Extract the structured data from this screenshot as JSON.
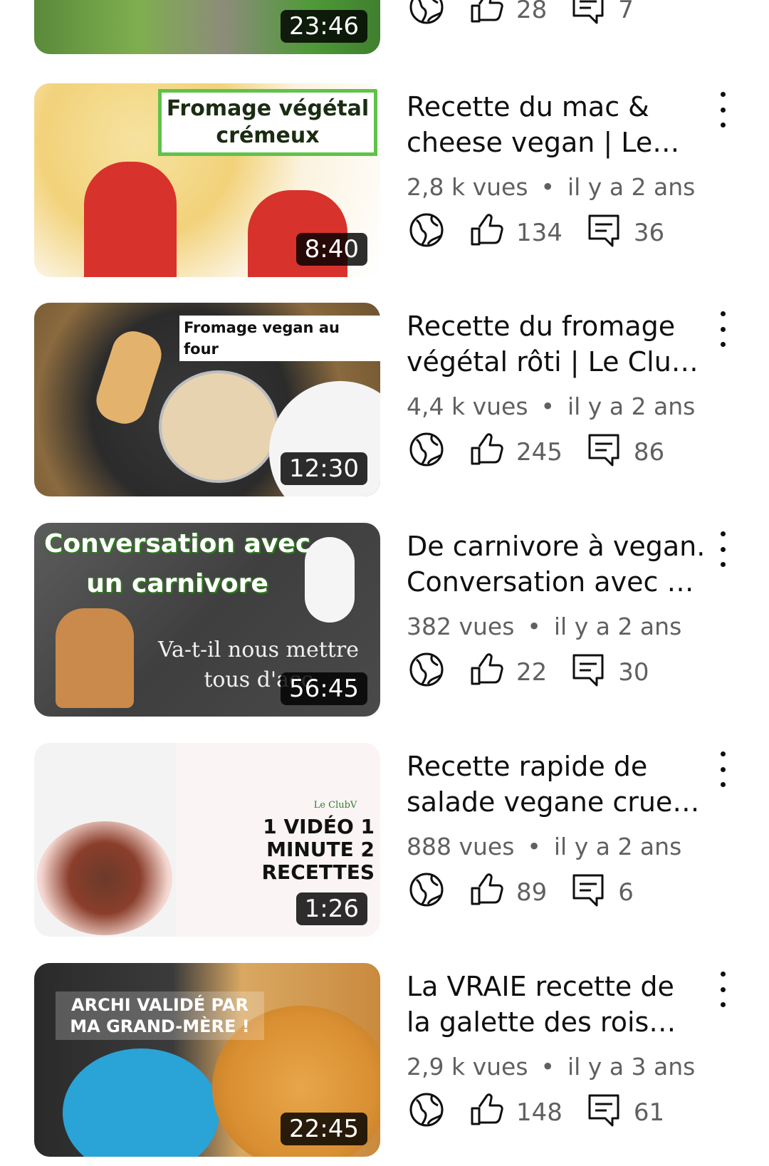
{
  "icons": {
    "visibility": "globe-icon",
    "likes": "thumbs-up-icon",
    "comments": "comment-icon",
    "menu": "more-vert-icon"
  },
  "colors": {
    "duration_bg": "#000000",
    "meta_text": "#606060",
    "title_text": "#0f0f0f"
  },
  "videos": [
    {
      "duration": "23:46",
      "likes": "28",
      "comments": "7"
    },
    {
      "thumb_text": "Fromage végétal crémeux",
      "title": "Recette du mac & cheese vegan | Le Club V",
      "views": "2,8 k vues",
      "age": "il y a 2 ans",
      "likes": "134",
      "comments": "36",
      "duration": "8:40"
    },
    {
      "thumb_text": "Fromage vegan au four",
      "title": "Recette du fromage végétal rôti | Le Club V",
      "views": "4,4 k vues",
      "age": "il y a 2 ans",
      "likes": "245",
      "comments": "86",
      "duration": "12:30"
    },
    {
      "thumb_text": "Conversation avec un carnivore",
      "thumb_subtext": "Va-t-il nous mettre tous d'acc",
      "title": "De carnivore à vegan. Conversation avec un carnivore",
      "views": "382 vues",
      "age": "il y a 2 ans",
      "likes": "22",
      "comments": "30",
      "duration": "56:45"
    },
    {
      "thumb_text": "1 VIDÉO 1 MINUTE 2 RECETTES",
      "thumb_logo": "Le ClubV",
      "title": "Recette rapide de salade vegane crue Le Club V",
      "views": "888 vues",
      "age": "il y a 2 ans",
      "likes": "89",
      "comments": "6",
      "duration": "1:26"
    },
    {
      "thumb_text": "ARCHI VALIDÉ PAR MA GRAND-MÈRE !",
      "title": "La VRAIE recette de la galette des rois vegan",
      "views": "2,9 k vues",
      "age": "il y a 3 ans",
      "likes": "148",
      "comments": "61",
      "duration": "22:45"
    }
  ]
}
